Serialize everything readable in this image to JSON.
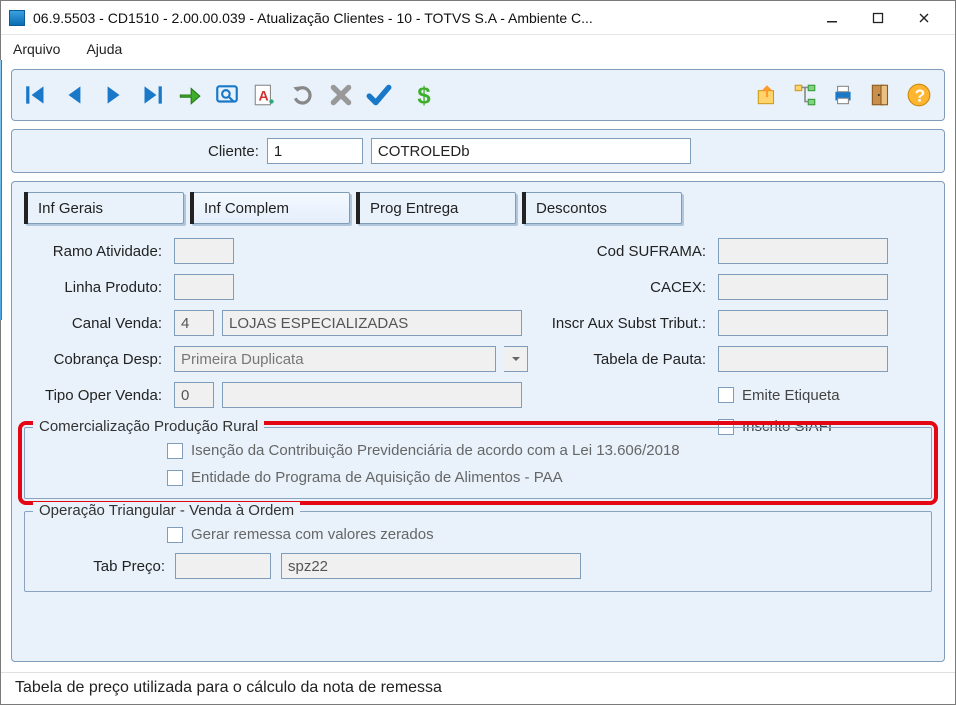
{
  "window": {
    "title": "06.9.5503 - CD1510 - 2.00.00.039 - Atualização Clientes - 10 - TOTVS S.A - Ambiente C..."
  },
  "menu": {
    "arquivo": "Arquivo",
    "ajuda": "Ajuda"
  },
  "client": {
    "label": "Cliente:",
    "code": "1",
    "name": "COTROLEDb"
  },
  "tabs": {
    "inf_gerais": "Inf Gerais",
    "inf_complem": "Inf Complem",
    "prog_entrega": "Prog Entrega",
    "descontos": "Descontos"
  },
  "labels": {
    "ramo_atividade": "Ramo Atividade:",
    "cod_suframa": "Cod SUFRAMA:",
    "linha_produto": "Linha Produto:",
    "cacex": "CACEX:",
    "canal_venda": "Canal Venda:",
    "inscr_aux": "Inscr Aux Subst Tribut.:",
    "cobranca_desp": "Cobrança Desp:",
    "tabela_pauta": "Tabela de Pauta:",
    "tipo_oper_venda": "Tipo Oper Venda:",
    "emite_etiqueta": "Emite Etiqueta",
    "inscrito_siafi": "Inscrito SIAFI",
    "tab_preco": "Tab Preço:"
  },
  "values": {
    "ramo_atividade": "",
    "cod_suframa": "",
    "linha_produto": "",
    "cacex": "",
    "canal_venda_code": "4",
    "canal_venda_desc": "LOJAS ESPECIALIZADAS",
    "inscr_aux": "",
    "cobranca_desp": "Primeira Duplicata",
    "tabela_pauta": "",
    "tipo_oper_venda_code": "0",
    "tipo_oper_venda_desc": "",
    "tab_preco_code": "",
    "tab_preco_desc": "spz22"
  },
  "groups": {
    "rural": {
      "legend": "Comercialização Produção Rural",
      "check_isencao": "Isenção da Contribuição Previdenciária de acordo com a Lei 13.606/2018",
      "check_paa": "Entidade do Programa de Aquisição de Alimentos - PAA"
    },
    "triangular": {
      "legend": "Operação Triangular - Venda à Ordem",
      "check_remessa": "Gerar remessa com valores zerados"
    }
  },
  "status_text": "Tabela de preço utilizada para o cálculo da nota de remessa",
  "icons": {
    "first": "first-icon",
    "prev": "prev-icon",
    "next": "next-icon",
    "last": "last-icon",
    "confirm": "confirm-icon",
    "search": "search-icon",
    "textsize": "textsize-icon",
    "undo": "undo-icon",
    "delete": "delete-icon",
    "check": "check-icon",
    "money": "money-icon",
    "export": "export-icon",
    "tree": "tree-icon",
    "print": "print-icon",
    "exit": "exit-icon",
    "help": "help-icon"
  }
}
